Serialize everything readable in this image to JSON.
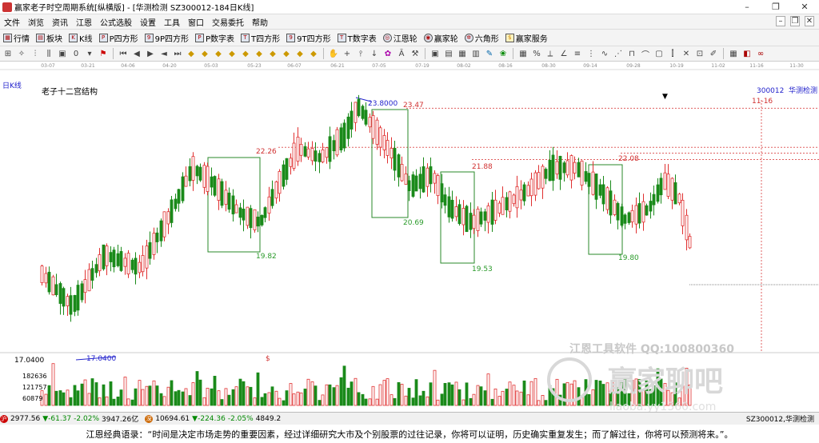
{
  "window": {
    "title": "赢家老子时空周期系统[纵横版] - [华测检测  SZ300012-184日K线]",
    "minimize": "–",
    "restore": "❐",
    "close": "✕"
  },
  "menu": {
    "items": [
      "文件",
      "浏览",
      "资讯",
      "江恩",
      "公式选股",
      "设置",
      "工具",
      "窗口",
      "交易委托",
      "帮助"
    ],
    "mdi_controls": [
      "–",
      "❐",
      "✕"
    ]
  },
  "toolbar1": {
    "items": [
      {
        "label": "行情",
        "icon": "grid-icon"
      },
      {
        "label": "板块",
        "icon": "block-icon"
      },
      {
        "label": "K线",
        "icon": "candle-icon"
      },
      {
        "label": "P四方形",
        "icon": "p-square-icon"
      },
      {
        "label": "9P四方形",
        "icon": "9p-square-icon"
      },
      {
        "label": "P数字表",
        "icon": "p-table-icon"
      },
      {
        "label": "T四方形",
        "icon": "t-square-icon"
      },
      {
        "label": "9T四方形",
        "icon": "9t-square-icon"
      },
      {
        "label": "T数字表",
        "icon": "t-table-icon"
      },
      {
        "label": "江恩轮",
        "icon": "gann-wheel-icon"
      },
      {
        "label": "赢家轮",
        "icon": "winner-wheel-icon"
      },
      {
        "label": "六角形",
        "icon": "hexagon-icon"
      },
      {
        "label": "赢家服务",
        "icon": "service-icon"
      }
    ]
  },
  "chart": {
    "period_label": "日K线",
    "study_title": "老子十二宫结构",
    "stock_code": "300012",
    "stock_name": "华测检测",
    "date_marker": "11-16",
    "date_ticks": [
      "03-07",
      "03-21",
      "04-06",
      "04-20",
      "05-03",
      "05-23",
      "06-07",
      "06-21",
      "07-05",
      "07-19",
      "08-02",
      "08-16",
      "08-30",
      "09-14",
      "09-28",
      "10-19",
      "11-02",
      "11-16",
      "11-30"
    ],
    "price_labels": [
      {
        "text": "23.8000",
        "color": "#2222cc"
      },
      {
        "text": "23.47",
        "color": "#d03030"
      },
      {
        "text": "22.26",
        "color": "#d03030"
      },
      {
        "text": "21.88",
        "color": "#d03030"
      },
      {
        "text": "22.08",
        "color": "#d03030"
      },
      {
        "text": "20.69",
        "color": "#2a9a2a"
      },
      {
        "text": "19.82",
        "color": "#2a9a2a"
      },
      {
        "text": "19.53",
        "color": "#2a9a2a"
      },
      {
        "text": "19.80",
        "color": "#2a9a2a"
      },
      {
        "text": "17.0400",
        "color": "#2222cc"
      }
    ],
    "left_price_label": "17.0400",
    "volume_labels": [
      "182636",
      "121757",
      "60879"
    ],
    "dollar_marker": "$",
    "watermark_line1": "江恩工具软件  QQ:100800360",
    "watermark_line2": "赢家聊吧",
    "watermark_line3": "liaoba.yy1360.com",
    "colors": {
      "up": "#e03030",
      "down": "#1a8a1a",
      "box": "#2a8a2a",
      "dashed": "#e03030"
    }
  },
  "statusbar": {
    "sh_index": "2977.56",
    "sh_change": "▼-61.37",
    "sh_pct": "-2.02%",
    "sh_amount": "3947.26亿",
    "sz_index": "10694.61",
    "sz_change": "▼-224.36",
    "sz_pct": "-2.05%",
    "sz_amount": "4849.2",
    "right_text": "SZ300012,华测检测"
  },
  "quote": {
    "text": "江恩经典语录：“时间是决定市场走势的重要因素，经过详细研究大市及个别股票的过往记录，你将可以证明，历史确实重复发生；而了解过往，你将可以预测将来。”。"
  }
}
